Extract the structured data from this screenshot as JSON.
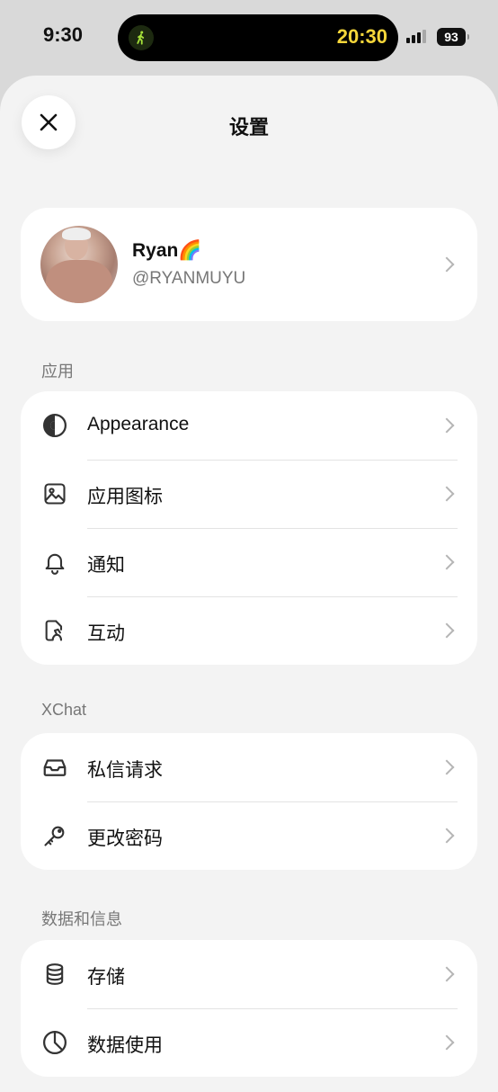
{
  "status_bar": {
    "time": "9:30",
    "live_activity_timer": "20:30",
    "battery": "93",
    "activity_icon": "walking-figure-icon"
  },
  "header": {
    "title": "设置",
    "close_icon": "close-icon"
  },
  "profile": {
    "name": "Ryan",
    "name_emoji": "🌈",
    "handle": "@RYANMUYU"
  },
  "sections": [
    {
      "label": "应用",
      "items": [
        {
          "label": "Appearance",
          "icon": "contrast-icon"
        },
        {
          "label": "应用图标",
          "icon": "image-icon"
        },
        {
          "label": "通知",
          "icon": "bell-icon"
        },
        {
          "label": "互动",
          "icon": "interaction-icon"
        }
      ]
    },
    {
      "label": "XChat",
      "items": [
        {
          "label": "私信请求",
          "icon": "inbox-icon"
        },
        {
          "label": "更改密码",
          "icon": "key-icon"
        }
      ]
    },
    {
      "label": "数据和信息",
      "items": [
        {
          "label": "存储",
          "icon": "database-icon"
        },
        {
          "label": "数据使用",
          "icon": "clock-icon"
        }
      ]
    }
  ],
  "colors": {
    "sheet_background": "#f3f3f3",
    "card_background": "#ffffff",
    "timer_yellow": "#f5d63a",
    "secondary_text": "#777777"
  }
}
